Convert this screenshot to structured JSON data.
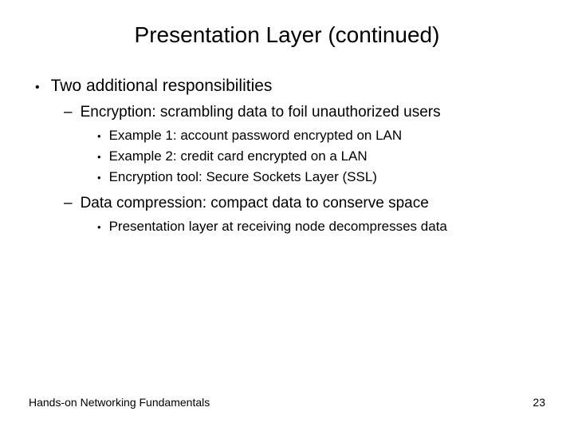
{
  "title": "Presentation Layer (continued)",
  "bullets": {
    "main": "Two additional responsibilities",
    "sub1": "Encryption: scrambling data to foil unauthorized users",
    "sub1_items": {
      "a": "Example 1: account password encrypted on LAN",
      "b": "Example 2: credit card encrypted on a LAN",
      "c": "Encryption tool: Secure Sockets Layer (SSL)"
    },
    "sub2": "Data compression: compact data to conserve space",
    "sub2_items": {
      "a": "Presentation layer at receiving node decompresses data"
    }
  },
  "footer": {
    "left": "Hands-on Networking Fundamentals",
    "right": "23"
  }
}
